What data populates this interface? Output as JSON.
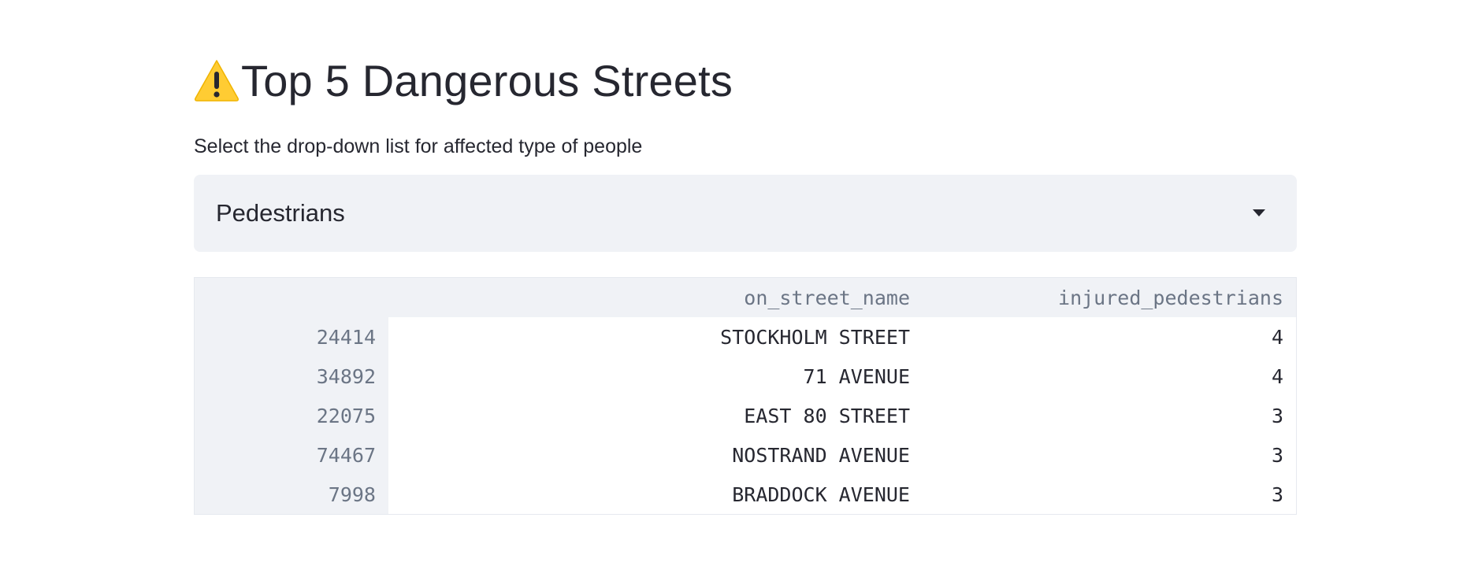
{
  "title": {
    "icon": "warning-emoji-icon",
    "text": "Top 5 Dangerous Streets"
  },
  "instruction": "Select the drop-down list for affected type of people",
  "select": {
    "selected_value": "Pedestrians",
    "caret_icon": "caret-down-icon"
  },
  "table": {
    "columns": [
      "",
      "on_street_name",
      "injured_pedestrians"
    ],
    "rows": [
      {
        "index": "24414",
        "on_street_name": "STOCKHOLM STREET",
        "injured_pedestrians": "4"
      },
      {
        "index": "34892",
        "on_street_name": "71 AVENUE",
        "injured_pedestrians": "4"
      },
      {
        "index": "22075",
        "on_street_name": "EAST 80 STREET",
        "injured_pedestrians": "3"
      },
      {
        "index": "74467",
        "on_street_name": "NOSTRAND AVENUE",
        "injured_pedestrians": "3"
      },
      {
        "index": "7998",
        "on_street_name": "BRADDOCK AVENUE",
        "injured_pedestrians": "3"
      }
    ]
  },
  "colors": {
    "text": "#262730",
    "muted_text": "#6b7585",
    "widget_background": "#f0f2f6",
    "warning_yellow": "#ffcc33"
  }
}
